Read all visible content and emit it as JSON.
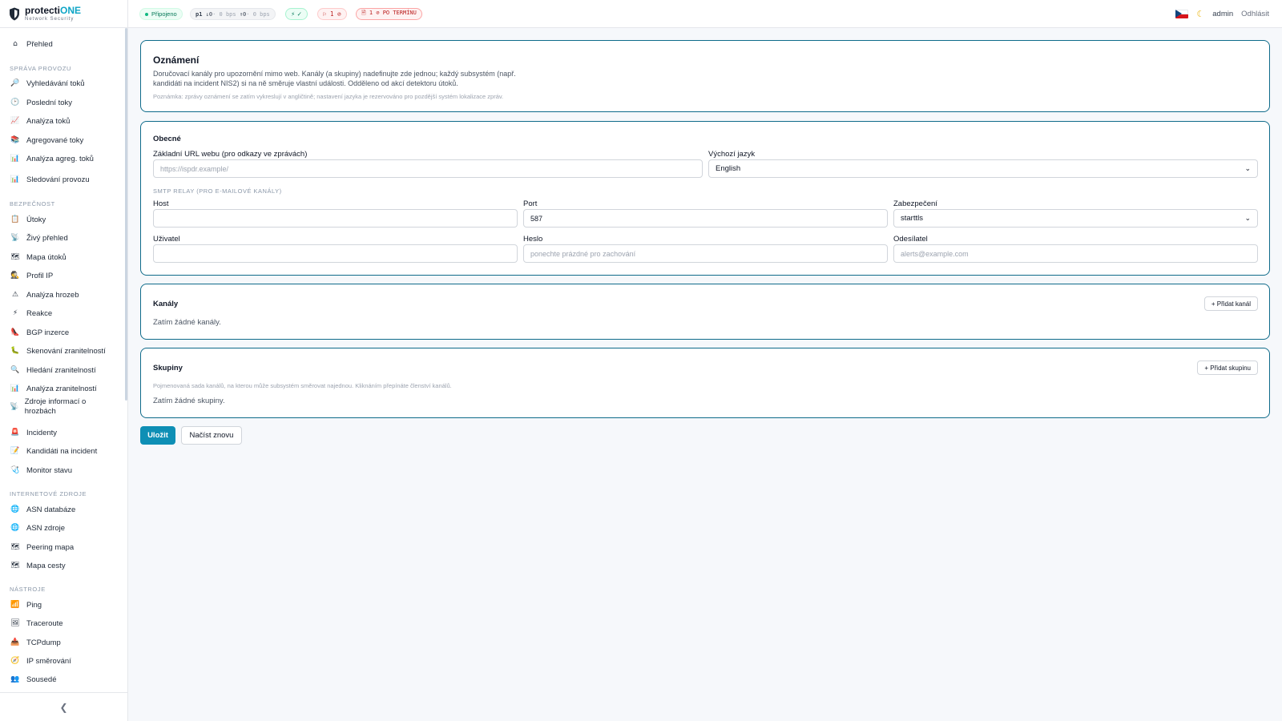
{
  "brand": {
    "name_prefix": "protecti",
    "name_accent": "ONE",
    "subtitle": "Network Security"
  },
  "sidebar": {
    "overview": {
      "icon": "⌂",
      "label": "Přehled"
    },
    "sections": [
      {
        "title": "Správa provozu",
        "items": [
          {
            "icon": "🔎",
            "label": "Vyhledávání toků"
          },
          {
            "icon": "🕑",
            "label": "Poslední toky"
          },
          {
            "icon": "📈",
            "label": "Analýza toků"
          },
          {
            "icon": "📚",
            "label": "Agregované toky"
          },
          {
            "icon": "📊",
            "label": "Analýza agreg. toků"
          },
          {
            "icon": "📊",
            "label": "Sledování provozu"
          }
        ]
      },
      {
        "title": "Bezpečnost",
        "items": [
          {
            "icon": "📋",
            "label": "Útoky"
          },
          {
            "icon": "📡",
            "label": "Živý přehled"
          },
          {
            "icon": "🗺",
            "label": "Mapa útoků"
          },
          {
            "icon": "🕵",
            "label": "Profil IP"
          },
          {
            "icon": "⚠",
            "label": "Analýza hrozeb"
          },
          {
            "icon": "⚡",
            "label": "Reakce"
          },
          {
            "icon": "👠",
            "label": "BGP inzerce"
          },
          {
            "icon": "🐛",
            "label": "Skenování zranitelností"
          },
          {
            "icon": "🔍",
            "label": "Hledání zranitelností"
          },
          {
            "icon": "📊",
            "label": "Analýza zranitelností"
          },
          {
            "icon": "📡",
            "label": "Zdroje informací o hrozbách"
          },
          {
            "icon": "🚨",
            "label": "Incidenty"
          },
          {
            "icon": "📝",
            "label": "Kandidáti na incident"
          },
          {
            "icon": "🩺",
            "label": "Monitor stavu"
          }
        ]
      },
      {
        "title": "Internetové zdroje",
        "items": [
          {
            "icon": "🌐",
            "label": "ASN databáze"
          },
          {
            "icon": "🌐",
            "label": "ASN zdroje"
          },
          {
            "icon": "🗺",
            "label": "Peering mapa"
          },
          {
            "icon": "🗺",
            "label": "Mapa cesty"
          }
        ]
      },
      {
        "title": "Nástroje",
        "items": [
          {
            "icon": "📶",
            "label": "Ping"
          },
          {
            "icon": "🖼",
            "label": "Traceroute"
          },
          {
            "icon": "📥",
            "label": "TCPdump"
          },
          {
            "icon": "🧭",
            "label": "IP směrování"
          },
          {
            "icon": "👥",
            "label": "Sousedé"
          }
        ]
      }
    ],
    "collapse": "❮"
  },
  "topbar": {
    "connected": "Připojeno",
    "rate_node": "p1",
    "rate_down": "↓0",
    "rate_down_unit": "· 0 bps",
    "rate_up": "↑0",
    "rate_up_unit": "· 0 bps",
    "ok": "⚡ ✓",
    "flag": "⚐ 1 ⊘",
    "overdue": "🗎 1 ⊘ PO TERMÍNU",
    "user": "admin",
    "logout": "Odhlásit"
  },
  "notifications": {
    "title": "Oznámení",
    "desc_line1": "Doručovací kanály pro upozornění mimo web. Kanály (a skupiny) nadefinujte zde jednou; každý subsystém (např.",
    "desc_line2": "kandidáti na incident NIS2) si na ně směruje vlastní události. Odděleno od akcí detektoru útoků.",
    "note": "Poznámka: zprávy oznámení se zatím vykreslují v angličtině; nastavení jazyka je rezervováno pro pozdější systém lokalizace zpráv."
  },
  "general": {
    "title": "Obecné",
    "base_url_label": "Základní URL webu (pro odkazy ve zprávách)",
    "base_url_placeholder": "https://ispdr.example/",
    "language_label": "Výchozí jazyk",
    "language_value": "English",
    "smtp_heading": "SMTP relay (pro e-mailové kanály)",
    "host_label": "Host",
    "port_label": "Port",
    "port_value": "587",
    "security_label": "Zabezpečení",
    "security_value": "starttls",
    "user_label": "Uživatel",
    "password_label": "Heslo",
    "password_placeholder": "ponechte prázdné pro zachování",
    "sender_label": "Odesílatel",
    "sender_placeholder": "alerts@example.com"
  },
  "channels": {
    "title": "Kanály",
    "add": "+ Přidat kanál",
    "empty": "Zatím žádné kanály."
  },
  "groups": {
    "title": "Skupiny",
    "add": "+ Přidat skupinu",
    "desc": "Pojmenovaná sada kanálů, na kterou může subsystém směrovat najednou. Kliknáním přepínáte členství kanálů.",
    "empty": "Zatím žádné skupiny."
  },
  "actions": {
    "save": "Uložit",
    "reload": "Načíst znovu"
  },
  "colors": {
    "accent": "#0e8fb5",
    "card_border": "#0f6b8a"
  }
}
